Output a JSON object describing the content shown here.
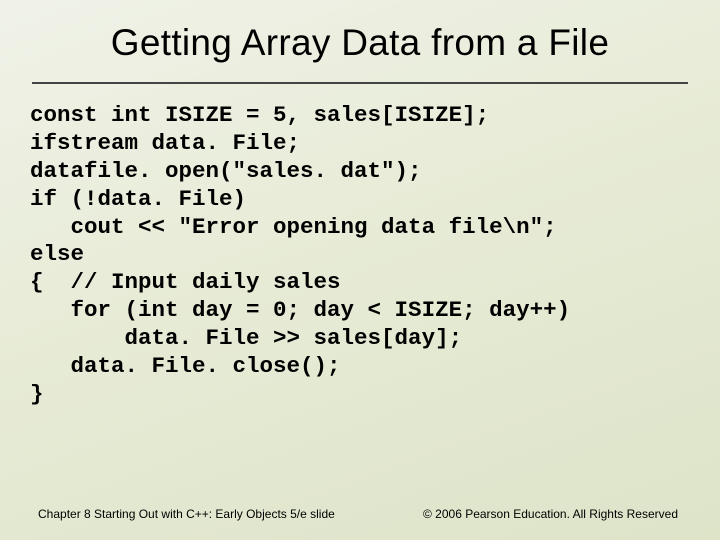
{
  "title": "Getting Array Data from a File",
  "code": "const int ISIZE = 5, sales[ISIZE];\nifstream data. File;\ndatafile. open(\"sales. dat\");\nif (!data. File)\n   cout << \"Error opening data file\\n\";\nelse\n{  // Input daily sales\n   for (int day = 0; day < ISIZE; day++)\n       data. File >> sales[day];\n   data. File. close();\n}",
  "footer_left": "Chapter 8 Starting Out with C++: Early Objects 5/e\nslide",
  "footer_right": "© 2006 Pearson Education.\nAll Rights Reserved"
}
